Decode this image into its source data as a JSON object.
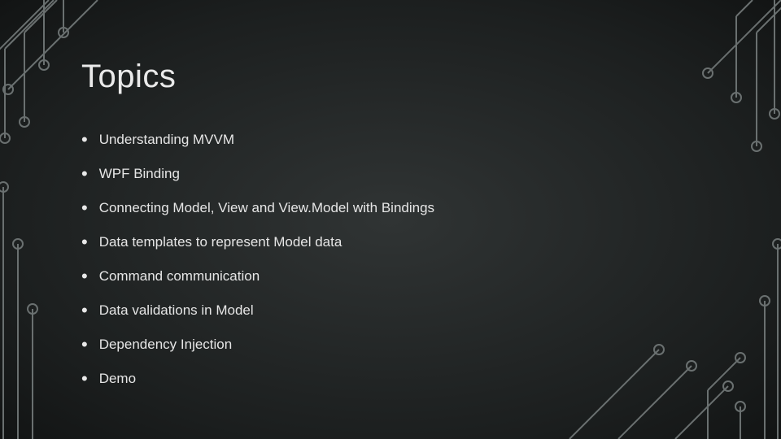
{
  "title": "Topics",
  "items": [
    "Understanding MVVM",
    "WPF Binding",
    "Connecting Model, View and View.Model with Bindings",
    "Data templates to represent Model data",
    "Command communication",
    "Data validations in Model",
    "Dependency Injection",
    "Demo"
  ]
}
